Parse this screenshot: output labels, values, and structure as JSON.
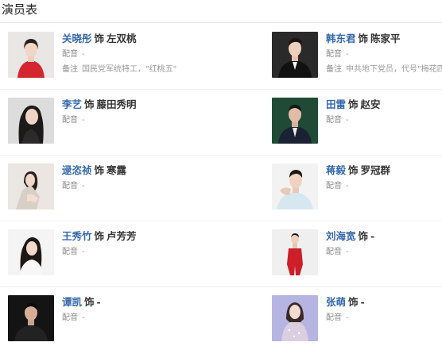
{
  "section": {
    "title": "演员表"
  },
  "cast": [
    {
      "actor": "关晓彤",
      "shi": "饰",
      "role": "左双桃",
      "peiyin_label": "配音",
      "peiyin": "-",
      "beizhu_label": "备注",
      "beizhu": "国民党军统特工，\"红桃五\"",
      "photo": "young-woman-red-top-portrait"
    },
    {
      "actor": "韩东君",
      "shi": "饰",
      "role": "陈家平",
      "peiyin_label": "配音",
      "peiyin": "-",
      "beizhu_label": "备注",
      "beizhu": "中共地下党员，代号\"梅花四\"",
      "photo": "man-black-suit-portrait"
    },
    {
      "actor": "李艺",
      "shi": "饰",
      "role": "藤田秀明",
      "peiyin_label": "配音",
      "peiyin": "-",
      "photo": "woman-long-dark-hair-portrait"
    },
    {
      "actor": "田雷",
      "shi": "饰",
      "role": "赵安",
      "peiyin_label": "配音",
      "peiyin": "-",
      "photo": "man-green-background-suit-portrait"
    },
    {
      "actor": "逯恣祯",
      "shi": "饰",
      "role": "寒露",
      "peiyin_label": "配音",
      "peiyin": "-",
      "photo": "woman-sitting-light-portrait"
    },
    {
      "actor": "蒋毅",
      "shi": "饰",
      "role": "罗冠群",
      "peiyin_label": "配音",
      "peiyin": "-",
      "photo": "man-white-shirt-portrait"
    },
    {
      "actor": "王秀竹",
      "shi": "饰",
      "role": "卢芳芳",
      "peiyin_label": "配音",
      "peiyin": "-",
      "photo": "woman-white-blouse-portrait"
    },
    {
      "actor": "刘海宽",
      "shi": "饰",
      "role": "-",
      "peiyin_label": "配音",
      "peiyin": "-",
      "photo": "man-red-suit-full-body"
    },
    {
      "actor": "谭凯",
      "shi": "饰",
      "role": "-",
      "peiyin_label": "配音",
      "peiyin": "-",
      "photo": "man-dark-background-portrait"
    },
    {
      "actor": "张萌",
      "shi": "饰",
      "role": "-",
      "peiyin_label": "配音",
      "peiyin": "-",
      "photo": "woman-sparkly-dress-portrait"
    }
  ]
}
